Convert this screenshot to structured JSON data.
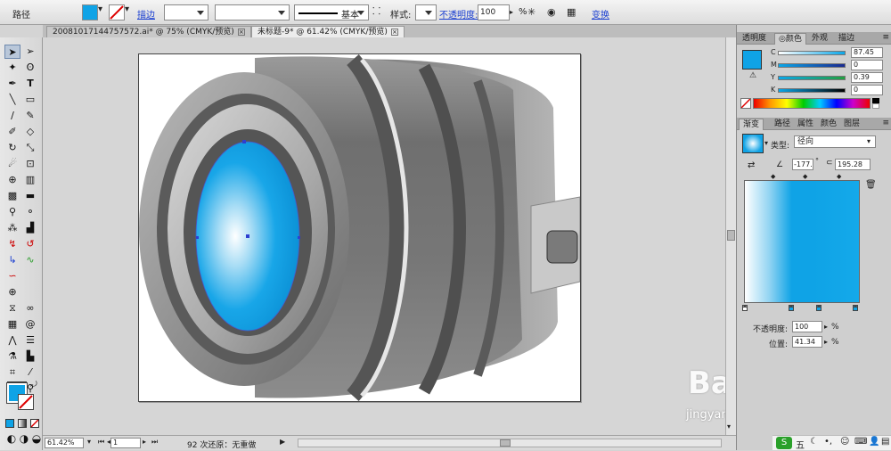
{
  "control_bar": {
    "object_type": "路径",
    "stroke_link": "描边",
    "stroke_profile": "基本",
    "style_label": "样式:",
    "opacity_link": "不透明度:",
    "opacity_value": "100",
    "opacity_unit": "%",
    "transform_link": "变换"
  },
  "doc_tabs": [
    {
      "label": "20081017144757572.ai* @ 75% (CMYK/预览)"
    },
    {
      "label": "未标题-9* @ 61.42% (CMYK/预览)"
    }
  ],
  "status_bar": {
    "zoom": "61.42%",
    "page": "1",
    "history": "92 次还原：无重做"
  },
  "color_panel": {
    "tabs": [
      "透明度",
      "颜色",
      "外观",
      "描边"
    ],
    "channels": [
      {
        "name": "C",
        "value": "87.45"
      },
      {
        "name": "M",
        "value": "0"
      },
      {
        "name": "Y",
        "value": "0.39"
      },
      {
        "name": "K",
        "value": "0"
      }
    ]
  },
  "gradient_panel": {
    "tabs": [
      "渐变",
      "路径",
      "属性",
      "颜色",
      "图层"
    ],
    "type_label": "类型:",
    "type_value": "径向",
    "angle_value": "-177.",
    "aspect_value": "195.28",
    "opacity_label": "不透明度:",
    "opacity_value": "100",
    "position_label": "位置:",
    "position_value": "41.34",
    "percent": "%"
  },
  "taskbar": {
    "ime": "五"
  },
  "watermark": {
    "brand": "Baidu经验",
    "url": "jingyan.baidu.com"
  },
  "colors": {
    "accent_blue": "#0fa3e6",
    "link_blue": "#1b3fd1",
    "lens_gray": "#6a6a6a"
  }
}
